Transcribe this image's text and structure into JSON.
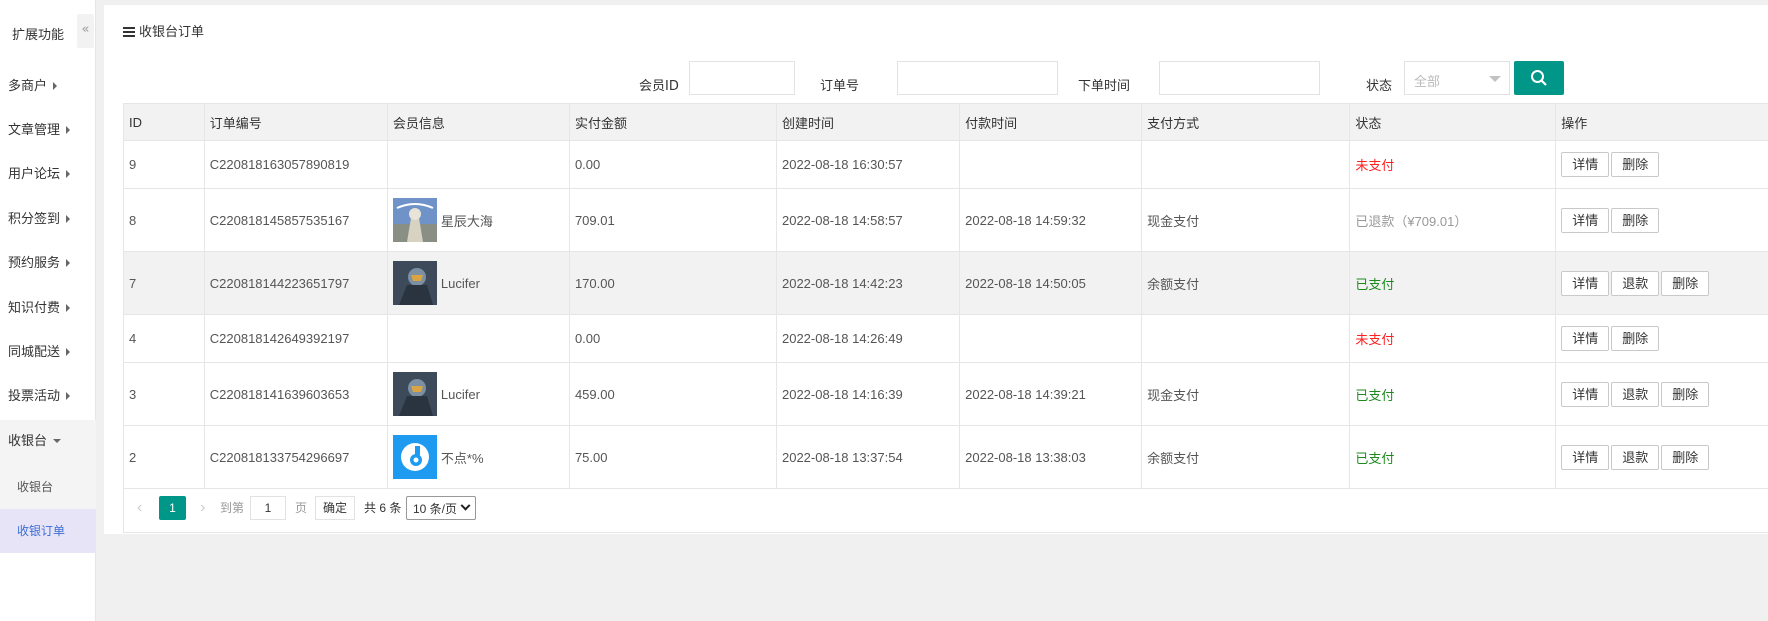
{
  "sidebar": {
    "title": "扩展功能",
    "collapse_icon": "«",
    "items": [
      {
        "label": "多商户"
      },
      {
        "label": "文章管理"
      },
      {
        "label": "用户论坛"
      },
      {
        "label": "积分签到"
      },
      {
        "label": "预约服务"
      },
      {
        "label": "知识付费"
      },
      {
        "label": "同城配送"
      },
      {
        "label": "投票活动"
      },
      {
        "label": "收银台"
      }
    ],
    "sub_items": [
      {
        "label": "收银台"
      },
      {
        "label": "收银订单"
      }
    ]
  },
  "panel": {
    "title": "收银台订单"
  },
  "filters": {
    "member_id_label": "会员ID",
    "member_id_value": "",
    "order_no_label": "订单号",
    "order_no_value": "",
    "order_time_label": "下单时间",
    "order_time_value": "",
    "status_label": "状态",
    "status_value": "全部"
  },
  "table": {
    "headers": {
      "id": "ID",
      "order_no": "订单编号",
      "member": "会员信息",
      "amount": "实付金额",
      "created": "创建时间",
      "paid": "付款时间",
      "pay_method": "支付方式",
      "status": "状态",
      "actions": "操作"
    },
    "rows": [
      {
        "id": "9",
        "order_no": "C220818163057890819",
        "member": "",
        "amount": "0.00",
        "created": "2022-08-18 16:30:57",
        "paid": "",
        "pay_method": "",
        "status": "未支付"
      },
      {
        "id": "8",
        "order_no": "C220818145857535167",
        "member": "星辰大海",
        "amount": "709.01",
        "created": "2022-08-18 14:58:57",
        "paid": "2022-08-18 14:59:32",
        "pay_method": "现金支付",
        "status": "已退款（¥709.01）"
      },
      {
        "id": "7",
        "order_no": "C220818144223651797",
        "member": "Lucifer",
        "amount": "170.00",
        "created": "2022-08-18 14:42:23",
        "paid": "2022-08-18 14:50:05",
        "pay_method": "余额支付",
        "status": "已支付"
      },
      {
        "id": "4",
        "order_no": "C220818142649392197",
        "member": "",
        "amount": "0.00",
        "created": "2022-08-18 14:26:49",
        "paid": "",
        "pay_method": "",
        "status": "未支付"
      },
      {
        "id": "3",
        "order_no": "C220818141639603653",
        "member": "Lucifer",
        "amount": "459.00",
        "created": "2022-08-18 14:16:39",
        "paid": "2022-08-18 14:39:21",
        "pay_method": "现金支付",
        "status": "已支付"
      },
      {
        "id": "2",
        "order_no": "C220818133754296697",
        "member": "不点*%",
        "amount": "75.00",
        "created": "2022-08-18 13:37:54",
        "paid": "2022-08-18 13:38:03",
        "pay_method": "余额支付",
        "status": "已支付"
      }
    ],
    "actions": {
      "detail": "详情",
      "refund": "退款",
      "delete": "删除"
    }
  },
  "pager": {
    "prev": "‹",
    "current": "1",
    "next": "›",
    "goto_label": "到第",
    "goto_value": "1",
    "page_label": "页",
    "confirm": "确定",
    "total": "共 6 条",
    "page_size": "10 条/页"
  },
  "colors": {
    "primary": "#009688",
    "unpaid": "#ff2020",
    "paid": "#1e8a1e",
    "refunded": "#999999"
  }
}
